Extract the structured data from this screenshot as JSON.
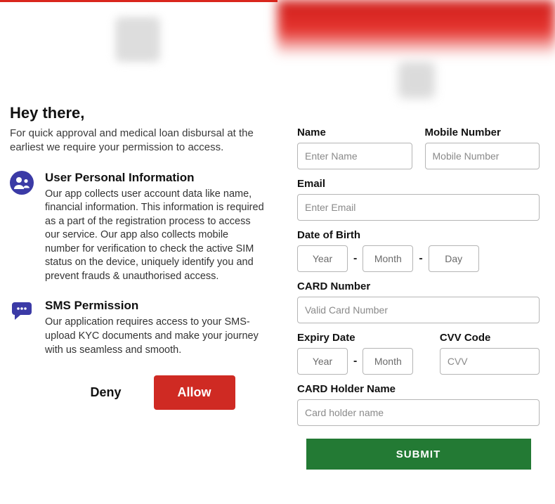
{
  "left": {
    "greeting": "Hey there,",
    "intro": "For quick approval and medical loan disbursal at the earliest we require your permission to access.",
    "sections": [
      {
        "icon": "user-group-icon",
        "title": "User Personal Information",
        "body": "Our app collects user account data like name, financial information. This information is required as a part of the registration process to access our service. Our app also collects mobile number for verification to check the active SIM status on the device, uniquely identify you and prevent frauds & unauthorised access."
      },
      {
        "icon": "sms-icon",
        "title": "SMS Permission",
        "body": "Our application requires access to your SMS-upload KYC documents and make your journey with us seamless and smooth."
      }
    ],
    "deny_label": "Deny",
    "allow_label": "Allow"
  },
  "right": {
    "fields": {
      "name_label": "Name",
      "name_placeholder": "Enter Name",
      "mobile_label": "Mobile Number",
      "mobile_placeholder": "Mobile Number",
      "email_label": "Email",
      "email_placeholder": "Enter Email",
      "dob_label": "Date of Birth",
      "dob_year": "Year",
      "dob_month": "Month",
      "dob_day": "Day",
      "card_label": "CARD Number",
      "card_placeholder": "Valid Card Number",
      "expiry_label": "Expiry Date",
      "expiry_year": "Year",
      "expiry_month": "Month",
      "cvv_label": "CVV Code",
      "cvv_placeholder": "CVV",
      "holder_label": "CARD Holder Name",
      "holder_placeholder": "Card holder name"
    },
    "submit_label": "SUBMIT"
  },
  "colors": {
    "brand_red": "#cf2a23",
    "submit_green": "#237a34",
    "icon_purple": "#3b3aa6"
  }
}
